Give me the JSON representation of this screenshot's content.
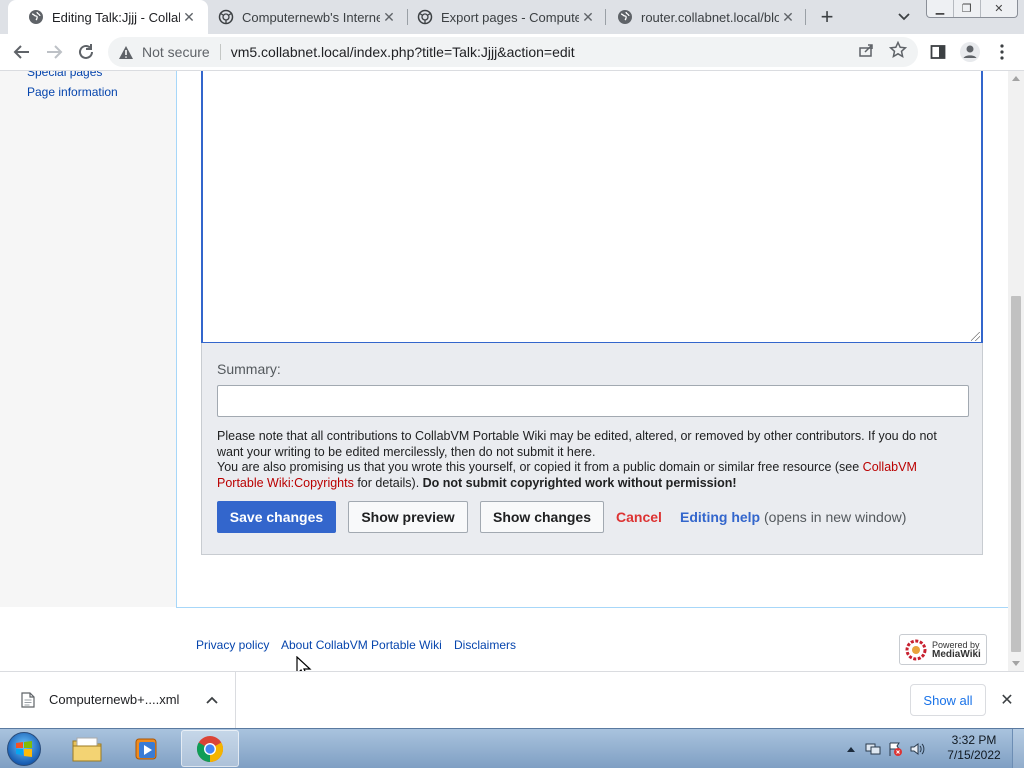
{
  "browser": {
    "tabs": [
      {
        "title": "Editing Talk:Jjjj - CollabVM",
        "active": true
      },
      {
        "title": "Computernewb's Internet",
        "active": false
      },
      {
        "title": "Export pages - Computer",
        "active": false
      },
      {
        "title": "router.collabnet.local/blo",
        "active": false
      }
    ],
    "security_label": "Not secure",
    "url": "vm5.collabnet.local/index.php?title=Talk:Jjjj&action=edit"
  },
  "sidebar": {
    "links": [
      "Special pages",
      "Page information"
    ]
  },
  "editor": {
    "textarea_value": "",
    "summary_label": "Summary:",
    "summary_value": "",
    "notice_part1": "Please note that all contributions to CollabVM Portable Wiki may be edited, altered, or removed by other contributors. If you do not want your writing to be edited mercilessly, then do not submit it here.",
    "notice_part2": "You are also promising us that you wrote this yourself, or copied it from a public domain or similar free resource (see ",
    "copyrights_link": "CollabVM Portable Wiki:Copyrights",
    "notice_part3": " for details). ",
    "notice_bold": "Do not submit copyrighted work without permission!",
    "save_label": "Save changes",
    "preview_label": "Show preview",
    "changes_label": "Show changes",
    "cancel_label": "Cancel",
    "help_label": "Editing help",
    "help_note": "(opens in new window)"
  },
  "footer": {
    "links": [
      "Privacy policy",
      "About CollabVM Portable Wiki",
      "Disclaimers"
    ],
    "powered_line1": "Powered by",
    "powered_line2": "MediaWiki"
  },
  "downloads": {
    "filename": "Computernewb+....xml",
    "show_all": "Show all"
  },
  "taskbar": {
    "time": "3:32 PM",
    "date": "7/15/2022"
  },
  "colors": {
    "link": "#0645ad",
    "primary_button": "#3366cc",
    "cancel": "#d33",
    "copyright_link": "#ba0000"
  }
}
